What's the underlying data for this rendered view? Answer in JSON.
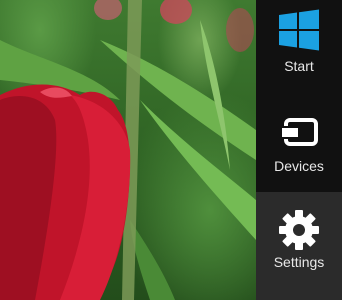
{
  "charms": {
    "start": {
      "label": "Start",
      "icon": "windows-logo-icon",
      "color": "#1ba1e2"
    },
    "devices": {
      "label": "Devices",
      "icon": "devices-icon"
    },
    "settings": {
      "label": "Settings",
      "icon": "gear-icon",
      "selected": true
    }
  },
  "colors": {
    "charms_bar": "#111111",
    "charm_selected": "#2b2b2b",
    "windows_blue": "#1ba1e2",
    "text": "#e8e8e8"
  }
}
